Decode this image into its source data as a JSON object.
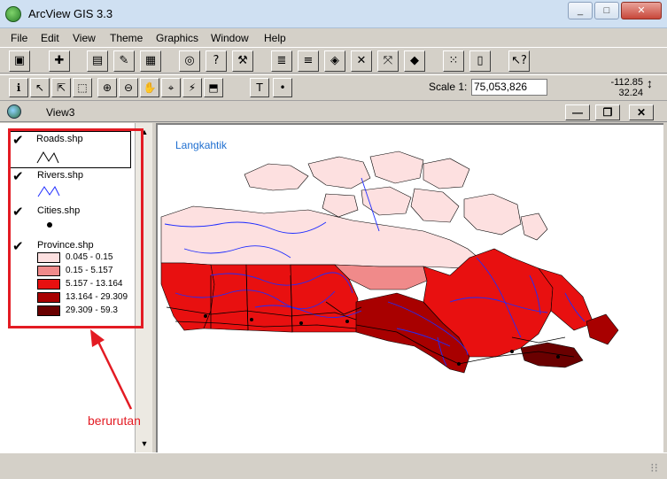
{
  "window": {
    "title": "ArcView GIS 3.3",
    "minimize": "_",
    "maximize": "□",
    "close": "✕"
  },
  "menu": [
    "File",
    "Edit",
    "View",
    "Theme",
    "Graphics",
    "Window",
    "Help"
  ],
  "toolbar1": [
    "save-icon",
    "add-theme-icon",
    "theme-properties-icon",
    "edit-legend-icon",
    "open-table-icon",
    "find-icon",
    "locate-icon",
    "hammer-icon",
    "select-by-theme-icon",
    "query-icon",
    "select-all-icon",
    "zoom-full-icon",
    "zoom-active-icon",
    "zoom-previous-icon",
    "zoom-selected-icon",
    "layout-icon",
    "help-icon"
  ],
  "toolbar2": [
    "identify-icon",
    "pointer-icon",
    "vertex-edit-icon",
    "select-feature-icon",
    "zoom-in-icon",
    "zoom-out-icon",
    "pan-icon",
    "measure-icon",
    "hot-link-icon",
    "area-select-icon",
    "text-icon",
    "draw-point-icon"
  ],
  "scale": {
    "label": "Scale 1:",
    "value": "75,053,826"
  },
  "coords": {
    "x": "-112.85",
    "y": "32.24"
  },
  "view": {
    "title": "View3"
  },
  "legend": {
    "themes": [
      {
        "name": "Roads.shp"
      },
      {
        "name": "Rivers.shp"
      },
      {
        "name": "Cities.shp"
      },
      {
        "name": "Province.shp"
      }
    ],
    "classes": [
      {
        "label": "0.045 - 0.15",
        "color": "#fde0e0"
      },
      {
        "label": "0.15 - 5.157",
        "color": "#f08a8a"
      },
      {
        "label": "5.157 - 13.164",
        "color": "#e81010"
      },
      {
        "label": "13.164 - 29.309",
        "color": "#a80000"
      },
      {
        "label": "29.309 - 59.3",
        "color": "#6a0000"
      }
    ]
  },
  "annotation": {
    "label": "berurutan"
  },
  "map": {
    "label": "Langkahtik",
    "colors": {
      "rivers": "#1e2cff",
      "roads": "#000000"
    }
  }
}
